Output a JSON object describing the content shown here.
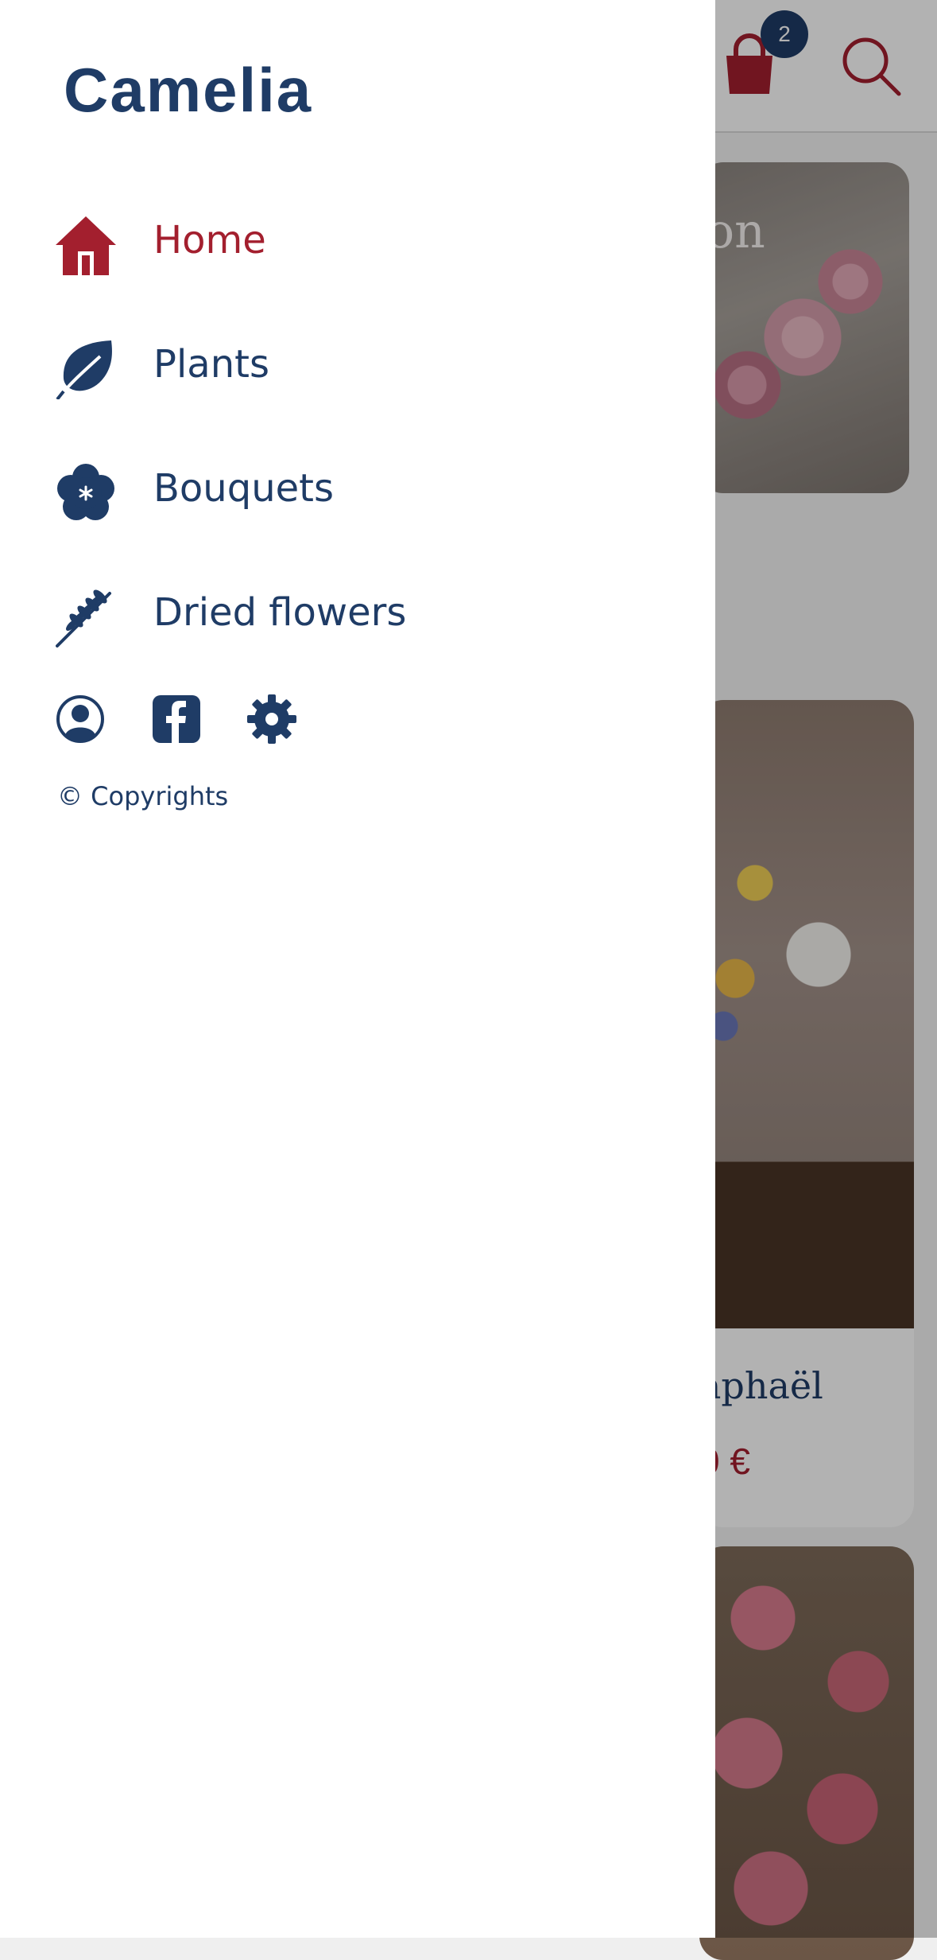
{
  "app": {
    "brand": "Camelia"
  },
  "header": {
    "cart_count": "2",
    "cart_icon": "shopping-bag-icon",
    "search_icon": "search-icon"
  },
  "background": {
    "hero_text_partial": "on",
    "product_name_partial": "aphaël",
    "product_price_partial": "0 €"
  },
  "drawer": {
    "nav": [
      {
        "label": "Home",
        "icon": "home-icon",
        "active": true
      },
      {
        "label": "Plants",
        "icon": "leaf-icon",
        "active": false
      },
      {
        "label": "Bouquets",
        "icon": "flower-icon",
        "active": false
      },
      {
        "label": "Dried flowers",
        "icon": "wheat-icon",
        "active": false
      }
    ],
    "social": [
      "account-icon",
      "facebook-icon",
      "settings-icon"
    ],
    "copyright": "© Copyrights"
  },
  "colors": {
    "primary": "#1f3c66",
    "accent": "#a31f2e",
    "drawer_bg": "#ffffff",
    "overlay": "rgba(0,0,0,0.30)"
  }
}
